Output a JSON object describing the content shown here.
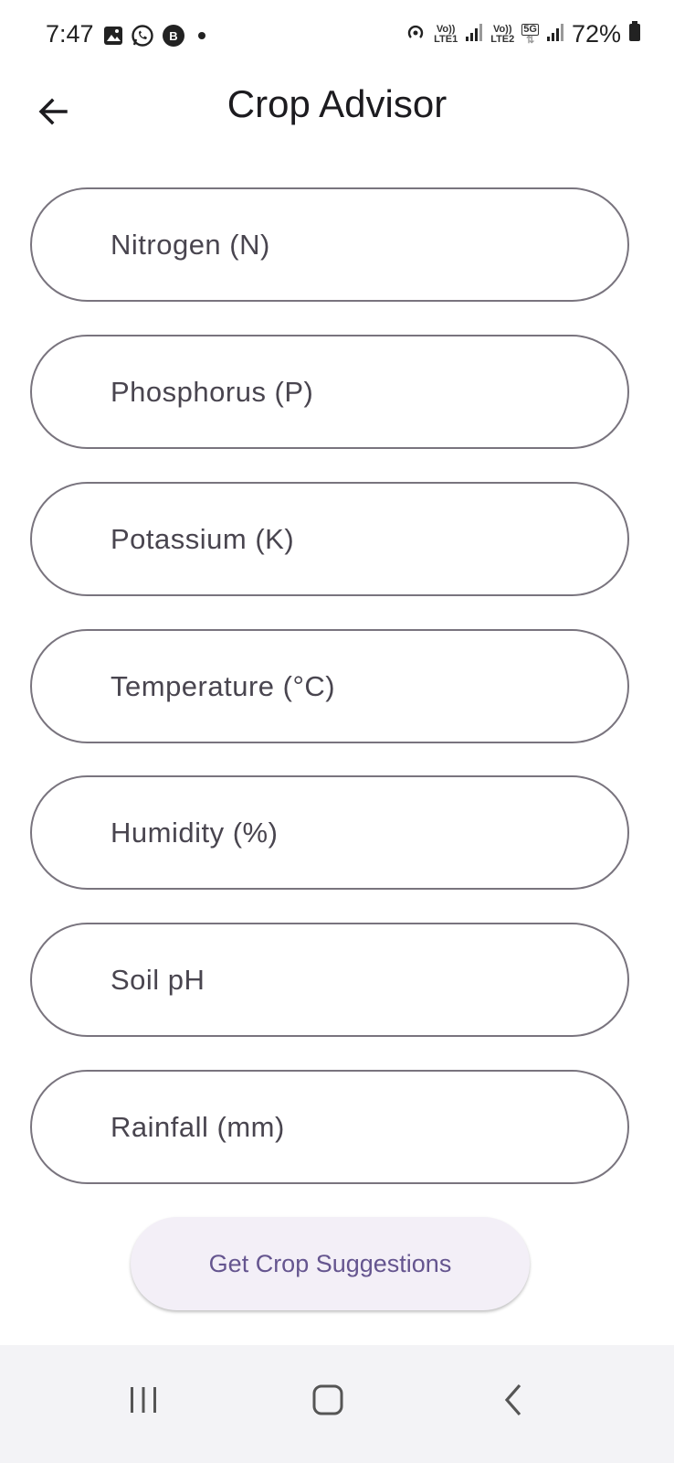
{
  "status_bar": {
    "time": "7:47",
    "sim1_label_top": "Vo))",
    "sim1_label_bottom": "LTE1",
    "sim2_label_top": "Vo))",
    "sim2_label_bottom": "LTE2",
    "network_badge": "5G",
    "battery": "72%",
    "notification_icons": [
      "gallery-icon",
      "whatsapp-icon",
      "whatsapp-business-icon",
      "dot-icon"
    ],
    "system_icons": [
      "hotspot-icon",
      "signal-icon",
      "signal-icon",
      "battery-icon"
    ]
  },
  "app_bar": {
    "title": "Crop Advisor",
    "back_icon": "arrow-left-icon"
  },
  "form": {
    "fields": [
      {
        "name": "nitrogen",
        "placeholder": "Nitrogen (N)",
        "value": ""
      },
      {
        "name": "phosphorus",
        "placeholder": "Phosphorus (P)",
        "value": ""
      },
      {
        "name": "potassium",
        "placeholder": "Potassium (K)",
        "value": ""
      },
      {
        "name": "temperature",
        "placeholder": "Temperature (°C)",
        "value": ""
      },
      {
        "name": "humidity",
        "placeholder": "Humidity (%)",
        "value": ""
      },
      {
        "name": "soil-ph",
        "placeholder": "Soil pH",
        "value": ""
      },
      {
        "name": "rainfall",
        "placeholder": "Rainfall (mm)",
        "value": ""
      }
    ],
    "submit_label": "Get Crop Suggestions"
  },
  "nav_bar": {
    "items": [
      "recent-apps-icon",
      "home-icon",
      "back-icon"
    ]
  },
  "colors": {
    "field_border": "#79747e",
    "button_bg": "#f3eff7",
    "button_text": "#65558f",
    "nav_bg": "#f3f3f6"
  }
}
